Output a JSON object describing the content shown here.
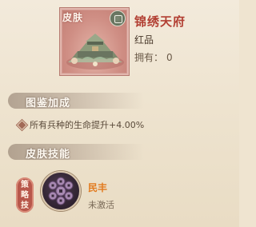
{
  "skin": {
    "tag": "皮肤",
    "seal_icon": "seal-icon",
    "name": "锦绣天府",
    "rarity": "红品",
    "owned_label": "拥有：",
    "owned_count": "0"
  },
  "collection": {
    "header": "图鉴加成",
    "bonus": "所有兵种的生命提升+4.00%"
  },
  "skills": {
    "header": "皮肤技能",
    "badge_chars": [
      "策",
      "略",
      "技"
    ],
    "skill_name": "民丰",
    "skill_status": "未激活"
  },
  "colors": {
    "name_red": "#b23f33",
    "skill_orange": "#e27a1e",
    "badge_red": "#b8574b"
  }
}
